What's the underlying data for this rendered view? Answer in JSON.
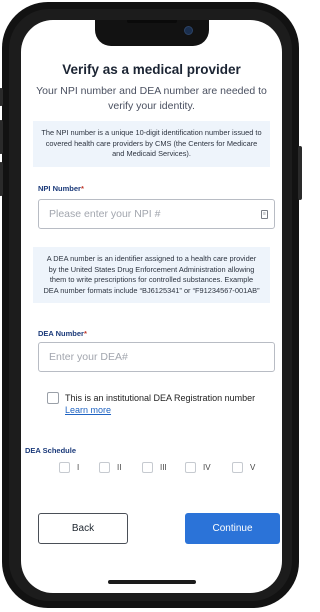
{
  "page": {
    "title": "Verify as a medical provider",
    "subtitle": "Your NPI number and DEA number are needed to verify your identity."
  },
  "npi": {
    "info": "The NPI number is a unique 10-digit identification number issued to covered health care providers by CMS (the Centers for Medicare and Medicaid Services).",
    "label": "NPI Number",
    "required_mark": "*",
    "placeholder": "Please enter your NPI #",
    "value": ""
  },
  "dea": {
    "info": "A DEA number is an identifier assigned to a health care provider by the United States Drug Enforcement Administration allowing them to write prescriptions for controlled substances. Example DEA number formats include “BJ6125341” or “F91234567-001AB”",
    "label": "DEA Number",
    "required_mark": "*",
    "placeholder": "Enter your DEA#",
    "value": ""
  },
  "institutional": {
    "label": "This is an institutional DEA Registration number",
    "link": "Learn more",
    "checked": false
  },
  "schedule": {
    "label": "DEA Schedule",
    "options": [
      "I",
      "II",
      "III",
      "IV",
      "V"
    ]
  },
  "actions": {
    "back_label": "Back",
    "continue_label": "Continue"
  },
  "colors": {
    "accent": "#2b73d8",
    "label": "#1b3a7a",
    "info_bg": "#eef4fb"
  }
}
